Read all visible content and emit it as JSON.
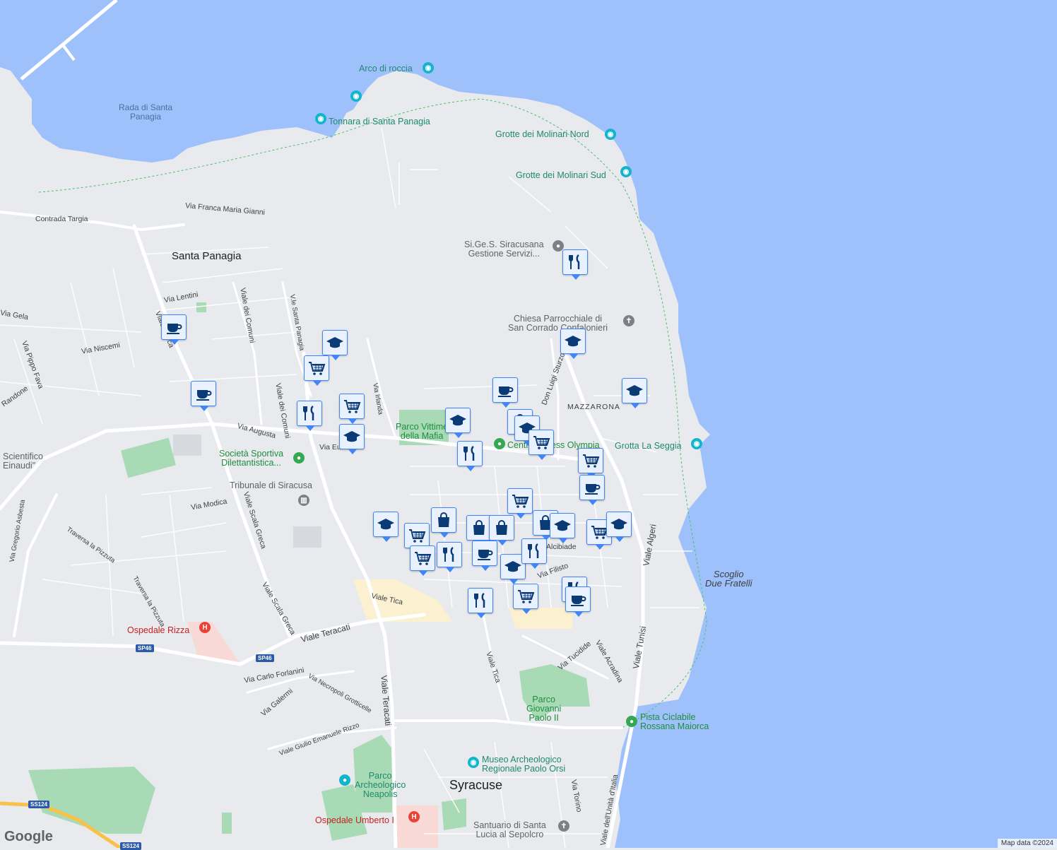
{
  "colors": {
    "sea": "#9fc1fb",
    "land": "#e8eaed",
    "park": "#a8dab5",
    "marker_border": "#4285f4",
    "marker_icon": "#0b3b75"
  },
  "water_labels": {
    "rada": "Rada di Santa\nPanagia"
  },
  "places": {
    "santa_panagia": "Santa Panagia",
    "syracuse": "Syracuse",
    "mazzarona": "MAZZARONA"
  },
  "pois": {
    "arco": "Arco di roccia",
    "tonnara": "Tonnara di Santa Panagia",
    "molinari_nord": "Grotte dei Molinari Nord",
    "molinari_sud": "Grotte dei Molinari Sud",
    "sigess": "Si.Ge.S. Siracusana\nGestione Servizi...",
    "chiesa": "Chiesa Parrocchiale di\nSan Corrado Confalonieri",
    "grotta_seggia": "Grotta La Seggia",
    "scoglio": "Scoglio\nDue Fratelli",
    "parco_vittime": "Parco Vittime\ndella Mafia",
    "societa": "Società Sportiva\nDilettantistica...",
    "tribunale": "Tribunale di Siracusa",
    "centro": "Centro Fitness Olympia",
    "scientifico": "Scientifico\nEinaudi\"",
    "rizza": "Ospedale Rizza",
    "parco_gp": "Parco\nGiovanni\nPaolo II",
    "pista": "Pista Ciclabile\nRossana Maiorca",
    "museo": "Museo Archeologico\nRegionale Paolo Orsi",
    "neapolis": "Parco\nArcheologico\nNeapolis",
    "umberto": "Ospedale Umberto I",
    "santuario": "Santuario di Santa\nLucia al Sepolcro"
  },
  "roads": {
    "contrada": "Contrada Targia",
    "gianni": "Via Franca Maria Gianni",
    "lentini": "Via Lentini",
    "gela": "Via Gela",
    "niscemi": "Via Niscemi",
    "pippo": "Via Pippo Fava",
    "randone": "Randone",
    "scala_greca_1": "Viale Scala Greca",
    "scala_greca_2": "Viale Scala Greca",
    "scala_greca_top": "Viale      Greca",
    "comuni": "Viale dei Comuni",
    "comuni2": "Viale dei Comuni",
    "santa_panagia": "V.le Santa Panagia",
    "augusta": "Via Augusta",
    "irlanda": "Via Irlanda",
    "modica": "Via Modica",
    "gregorio": "Via Gregorio Asbesta",
    "pizzuta": "Traversa la Pizzuta",
    "pizzuta2": "Traversa la Pizzuta",
    "teracati": "Viale Teracati",
    "teracati2": "Viale Teracati",
    "forlanini": "Via Carlo Forlanini",
    "galermi": "Via Galermi",
    "necropoli": "Via Necropoli Grotticelle",
    "rizzo": "Viale Giulio Emanuele Rizzo",
    "tica": "Viale Tica",
    "tica2": "Viale Tica",
    "sturzo": "Don Luigi Sturzo",
    "algeri": "Viale Algeri",
    "tunisi": "Viale Tunisi",
    "tucidide": "Via Tucidide",
    "acradina": "Viale Acradina",
    "unita": "Viale dell'Unità d'Italia",
    "torino": "Via Torino",
    "alcibiade": "Alcibiade",
    "filisto": "Via Filisto",
    "eur": "Via Eur"
  },
  "shields": {
    "sp46a": "SP46",
    "sp46b": "SP46",
    "ss124a": "SS124",
    "ss124b": "SS124"
  },
  "logo": "Google",
  "attribution": "Map data ©2024",
  "markers": [
    {
      "type": "cafe-icon",
      "label": "cafe"
    },
    {
      "type": "cafe-icon",
      "label": "cafe"
    },
    {
      "type": "school-icon",
      "label": "school"
    },
    {
      "type": "grocery-icon",
      "label": "grocery"
    },
    {
      "type": "restaurant-icon",
      "label": "restaurant"
    },
    {
      "type": "grocery-icon",
      "label": "grocery"
    },
    {
      "type": "school-icon",
      "label": "school"
    },
    {
      "type": "school-icon",
      "label": "school"
    },
    {
      "type": "restaurant-icon",
      "label": "restaurant"
    },
    {
      "type": "cafe-icon",
      "label": "cafe"
    },
    {
      "type": "shopping-icon",
      "label": "shopping"
    },
    {
      "type": "school-icon",
      "label": "school"
    },
    {
      "type": "grocery-icon",
      "label": "grocery"
    },
    {
      "type": "school-icon",
      "label": "school"
    },
    {
      "type": "restaurant-icon",
      "label": "restaurant"
    },
    {
      "type": "school-icon",
      "label": "school"
    },
    {
      "type": "grocery-icon",
      "label": "grocery"
    },
    {
      "type": "cafe-icon",
      "label": "cafe"
    },
    {
      "type": "grocery-icon",
      "label": "grocery"
    },
    {
      "type": "school-icon",
      "label": "school"
    },
    {
      "type": "grocery-icon",
      "label": "grocery"
    },
    {
      "type": "shopping-icon",
      "label": "shopping"
    },
    {
      "type": "shopping-icon",
      "label": "shopping"
    },
    {
      "type": "shopping-icon",
      "label": "shopping"
    },
    {
      "type": "grocery-icon",
      "label": "grocery"
    },
    {
      "type": "restaurant-icon",
      "label": "restaurant"
    },
    {
      "type": "cafe-icon",
      "label": "cafe"
    },
    {
      "type": "restaurant-icon",
      "label": "restaurant"
    },
    {
      "type": "school-icon",
      "label": "school"
    },
    {
      "type": "shopping-icon",
      "label": "shopping"
    },
    {
      "type": "school-icon",
      "label": "school"
    },
    {
      "type": "grocery-icon",
      "label": "grocery"
    },
    {
      "type": "school-icon",
      "label": "school"
    },
    {
      "type": "restaurant-icon",
      "label": "restaurant"
    },
    {
      "type": "grocery-icon",
      "label": "grocery"
    },
    {
      "type": "restaurant-icon",
      "label": "restaurant"
    },
    {
      "type": "cafe-icon",
      "label": "cafe"
    }
  ]
}
